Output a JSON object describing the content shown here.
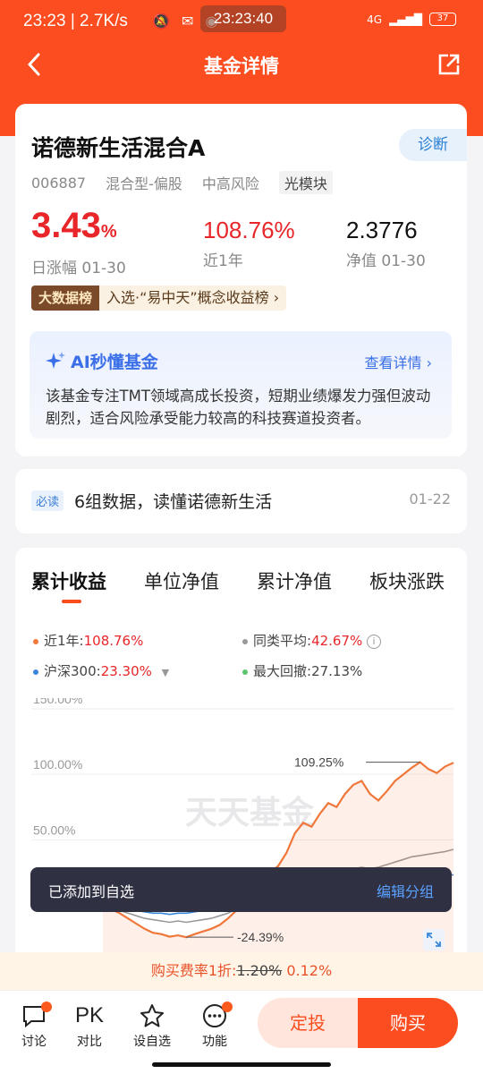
{
  "status": {
    "time": "23:23",
    "speed": "2.7K/s",
    "clock": "23:23:40",
    "battery": "37",
    "network": "4G"
  },
  "nav": {
    "title": "基金详情"
  },
  "fund": {
    "name": "诺德新生活混合A",
    "diagnose": "诊断",
    "code": "006887",
    "type": "混合型-偏股",
    "risk": "中高风险",
    "sector": "光模块",
    "daily_change": "3.43",
    "daily_unit": "%",
    "daily_label": "日涨幅 01-30",
    "year_return": "108.76%",
    "year_label": "近1年",
    "nav_value": "2.3776",
    "nav_label": "净值 01-30",
    "bigdata_badge": "大数据榜",
    "bigdata_text": "入选·“易中天”概念收益榜 ›"
  },
  "ai": {
    "title": "AI秒懂基金",
    "more": "查看详情 ›",
    "desc": "该基金专注TMT领域高成长投资，短期业绩爆发力强但波动剧烈，适合风险承受能力较高的科技赛道投资者。"
  },
  "must_read": {
    "tag": "必读",
    "text": "6组数据，读懂诺德新生活",
    "date": "01-22"
  },
  "tabs": [
    "累计收益",
    "单位净值",
    "累计净值",
    "板块涨跌"
  ],
  "legend": {
    "fund_label": "近1年:",
    "fund_value": "108.76%",
    "avg_label": "同类平均:",
    "avg_value": "42.67%",
    "hs300_label": "沪深300:",
    "hs300_value": "23.30%",
    "drawdown_label": "最大回撤:",
    "drawdown_value": "27.13%"
  },
  "chart_data": {
    "type": "line",
    "yticks": [
      "150.00%",
      "100.00%",
      "50.00%"
    ],
    "ylim": [
      -40,
      150
    ],
    "max_label": "109.25%",
    "min_label": "-24.39%",
    "watermark": "天天基金",
    "series": [
      {
        "name": "近1年",
        "color": "#f0773a",
        "values": [
          0,
          -3,
          -6,
          -10,
          -14,
          -18,
          -21,
          -22,
          -24,
          -23,
          -24.39,
          -22,
          -20,
          -18,
          -15,
          -10,
          -4,
          4,
          10,
          20,
          25,
          30,
          40,
          55,
          63,
          60,
          70,
          78,
          75,
          85,
          92,
          95,
          85,
          80,
          87,
          95,
          100,
          105,
          109.25,
          104,
          101,
          106,
          108.76
        ]
      },
      {
        "name": "同类平均",
        "color": "#999999",
        "values": [
          0,
          -2,
          -4,
          -6,
          -8,
          -10,
          -11,
          -12,
          -13,
          -12,
          -13,
          -12,
          -11,
          -10,
          -8,
          -6,
          -3,
          0,
          3,
          6,
          9,
          12,
          14,
          17,
          20,
          21,
          22,
          23,
          24,
          26,
          28,
          29,
          28,
          29,
          31,
          33,
          35,
          37,
          38,
          39,
          40,
          41,
          42.67
        ]
      },
      {
        "name": "沪深300",
        "color": "#3a86d8",
        "values": [
          0,
          -1,
          -2,
          -3,
          -4,
          -5,
          -6,
          -6,
          -7,
          -6,
          -6,
          -5,
          -4,
          -3,
          -2,
          -1,
          0,
          1,
          2,
          4,
          5,
          6,
          7,
          8,
          9,
          10,
          11,
          12,
          12,
          13,
          14,
          15,
          15,
          16,
          17,
          18,
          19,
          20,
          21,
          21,
          22,
          22.5,
          23.3
        ]
      }
    ]
  },
  "toast": {
    "text": "已添加到自选",
    "action": "编辑分组"
  },
  "fee": {
    "label": "购买费率1折:",
    "original": "1.20%",
    "current": "0.12%"
  },
  "bottom": {
    "discuss": "讨论",
    "pk_icon": "PK",
    "pk": "对比",
    "watch": "设自选",
    "func": "功能",
    "fixed": "定投",
    "buy": "购买"
  }
}
